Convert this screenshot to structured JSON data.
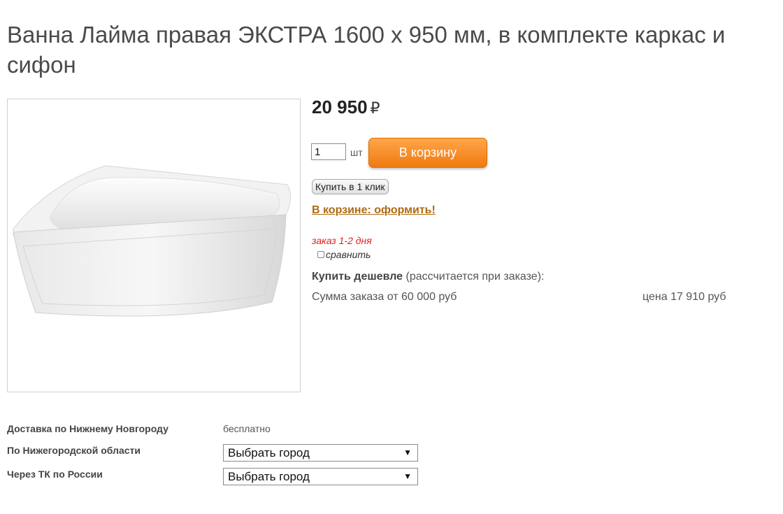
{
  "product": {
    "title": "Ванна Лайма правая ЭКСТРА 1600 х 950 мм, в комплекте каркас и сифон",
    "price": "20 950",
    "currency": "₽"
  },
  "purchase": {
    "quantity": "1",
    "unit": "шт",
    "cart_button": "В корзину",
    "one_click_button": "Купить в 1 клик",
    "in_cart_link": "В корзине: оформить!",
    "order_time": "заказ 1-2 дня",
    "compare_label": "сравнить",
    "compare_checked": false
  },
  "discount": {
    "heading": "Купить дешевле",
    "note": "(рассчитается при заказе):",
    "condition": "Сумма заказа от 60 000 руб",
    "price": "цена 17 910 руб"
  },
  "delivery": {
    "rows": [
      {
        "label": "Доставка по Нижнему Новгороду",
        "value": "бесплатно"
      },
      {
        "label": "По Нижегородской области",
        "select": "Выбрать город"
      },
      {
        "label": "Через ТК по России",
        "select": "Выбрать город"
      }
    ]
  },
  "icons": {
    "select_arrow": "▼"
  },
  "colors": {
    "cart_button": "#f58a1f",
    "in_cart_link": "#b06a12",
    "order_time": "#e02020"
  }
}
